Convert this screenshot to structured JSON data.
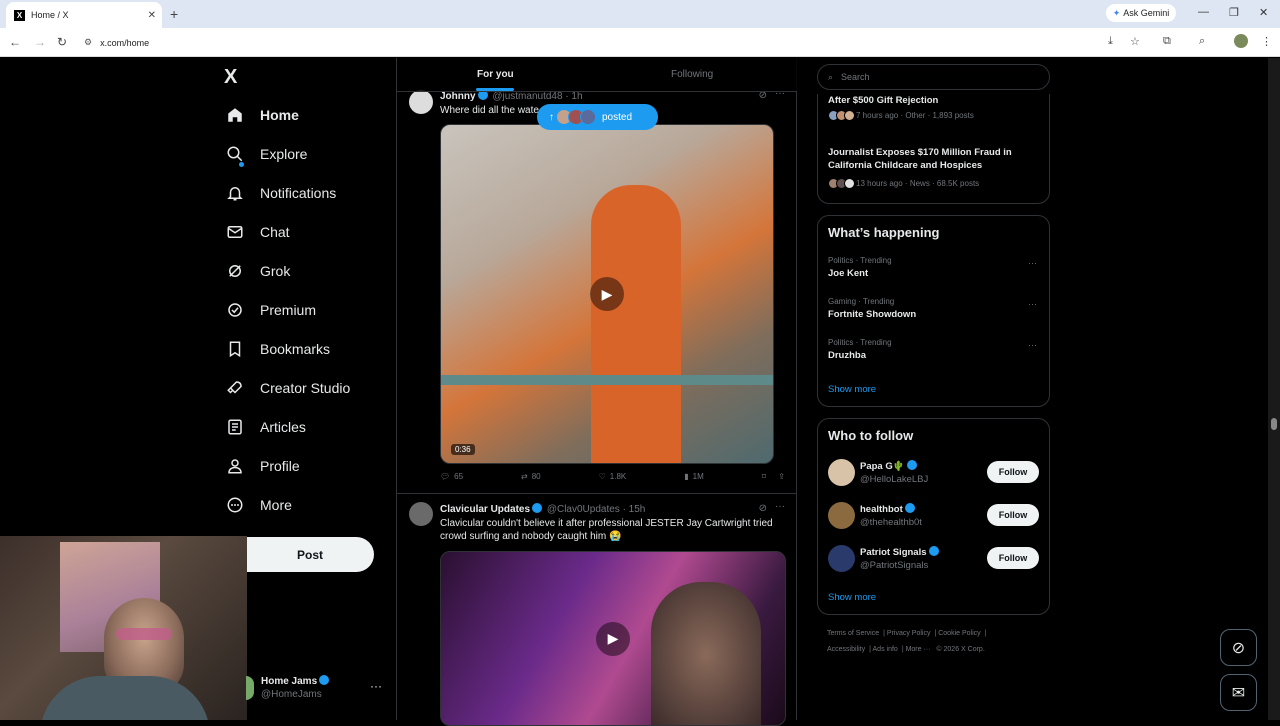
{
  "browser": {
    "tab_title": "Home / X",
    "url": "x.com/home",
    "ask_gemini": "Ask Gemini"
  },
  "sidebar": {
    "logo": "X",
    "items": [
      {
        "label": "Home",
        "icon": "home-icon"
      },
      {
        "label": "Explore",
        "icon": "search-icon"
      },
      {
        "label": "Notifications",
        "icon": "bell-icon"
      },
      {
        "label": "Chat",
        "icon": "mail-icon"
      },
      {
        "label": "Grok",
        "icon": "grok-icon"
      },
      {
        "label": "Premium",
        "icon": "verified-icon"
      },
      {
        "label": "Bookmarks",
        "icon": "bookmark-icon"
      },
      {
        "label": "Creator Studio",
        "icon": "rocket-icon"
      },
      {
        "label": "Articles",
        "icon": "article-icon"
      },
      {
        "label": "Profile",
        "icon": "person-icon"
      },
      {
        "label": "More",
        "icon": "more-circle-icon"
      }
    ],
    "post_button": "Post",
    "account": {
      "name": "Home Jams",
      "handle": "@HomeJams"
    }
  },
  "feed": {
    "tabs": [
      "For you",
      "Following"
    ],
    "posted_pill": "posted",
    "tweets": [
      {
        "name": "Johnny",
        "handle": "@justmanutd48",
        "time": "· 1h",
        "text": "Where did all the wate",
        "duration": "0:36",
        "replies": "65",
        "reposts": "80",
        "likes": "1.8K",
        "views": "1M"
      },
      {
        "name": "Clavicular Updates",
        "handle": "@Clav0Updates",
        "time": "· 15h",
        "text": "Clavicular couldn't believe it after professional JESTER Jay Cartwright tried crowd surfing and nobody caught him 😭"
      }
    ]
  },
  "right": {
    "search_placeholder": "Search",
    "news": [
      {
        "title": "After $500 Gift Rejection",
        "meta": "7 hours ago · Other · 1,893 posts"
      },
      {
        "title": "Journalist Exposes $170 Million Fraud in California Childcare and Hospices",
        "meta": "13 hours ago · News · 68.5K posts"
      }
    ],
    "happening_title": "What’s happening",
    "trends": [
      {
        "category": "Politics · Trending",
        "name": "Joe Kent"
      },
      {
        "category": "Gaming · Trending",
        "name": "Fortnite Showdown"
      },
      {
        "category": "Politics · Trending",
        "name": "Druzhba"
      }
    ],
    "show_more": "Show more",
    "who_to_follow_title": "Who to follow",
    "follow_suggestions": [
      {
        "name": "Papa G🌵",
        "handle": "@HelloLakeLBJ"
      },
      {
        "name": "healthbot",
        "handle": "@thehealthb0t"
      },
      {
        "name": "Patriot Signals",
        "handle": "@PatriotSignals"
      }
    ],
    "follow_label": "Follow",
    "footer": [
      "Terms of Service",
      "Privacy Policy",
      "Cookie Policy",
      "Accessibility",
      "Ads info",
      "More ···",
      "© 2026 X Corp."
    ]
  }
}
